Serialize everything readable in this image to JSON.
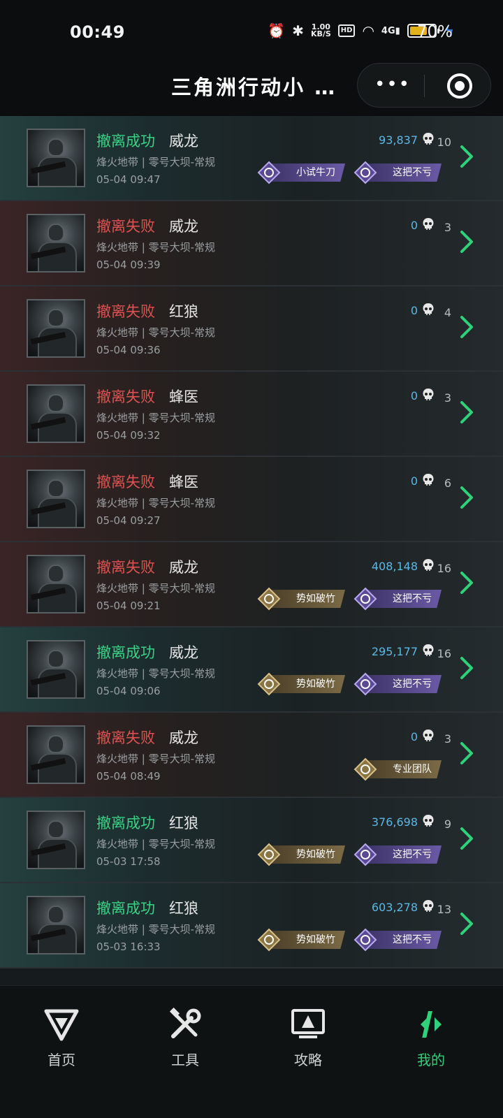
{
  "status_bar": {
    "time": "00:49",
    "speed_top": "1.00",
    "speed_bottom": "KB/S",
    "hd": "HD",
    "network": "4G",
    "battery_pct": "70%",
    "battery_level": 0.7
  },
  "header": {
    "title": "三角洲行动小 …"
  },
  "records": [
    {
      "result": "撤离成功",
      "result_type": "success",
      "operator": "威龙",
      "map": "烽火地带 | 零号大坝-常规",
      "time": "05-04 09:47",
      "value": "93,837",
      "kills": "10",
      "badges": [
        {
          "label": "小试牛刀",
          "color": "purple"
        },
        {
          "label": "这把不亏",
          "color": "purple"
        }
      ]
    },
    {
      "result": "撤离失败",
      "result_type": "fail",
      "operator": "威龙",
      "map": "烽火地带 | 零号大坝-常规",
      "time": "05-04 09:39",
      "value": "0",
      "kills": "3",
      "badges": []
    },
    {
      "result": "撤离失败",
      "result_type": "fail",
      "operator": "红狼",
      "map": "烽火地带 | 零号大坝-常规",
      "time": "05-04 09:36",
      "value": "0",
      "kills": "4",
      "badges": []
    },
    {
      "result": "撤离失败",
      "result_type": "fail",
      "operator": "蜂医",
      "map": "烽火地带 | 零号大坝-常规",
      "time": "05-04 09:32",
      "value": "0",
      "kills": "3",
      "badges": []
    },
    {
      "result": "撤离失败",
      "result_type": "fail",
      "operator": "蜂医",
      "map": "烽火地带 | 零号大坝-常规",
      "time": "05-04 09:27",
      "value": "0",
      "kills": "6",
      "badges": []
    },
    {
      "result": "撤离失败",
      "result_type": "fail",
      "operator": "威龙",
      "map": "烽火地带 | 零号大坝-常规",
      "time": "05-04 09:21",
      "value": "408,148",
      "kills": "16",
      "badges": [
        {
          "label": "势如破竹",
          "color": "gold"
        },
        {
          "label": "这把不亏",
          "color": "purple"
        }
      ]
    },
    {
      "result": "撤离成功",
      "result_type": "success",
      "operator": "威龙",
      "map": "烽火地带 | 零号大坝-常规",
      "time": "05-04 09:06",
      "value": "295,177",
      "kills": "16",
      "badges": [
        {
          "label": "势如破竹",
          "color": "gold"
        },
        {
          "label": "这把不亏",
          "color": "purple"
        }
      ]
    },
    {
      "result": "撤离失败",
      "result_type": "fail",
      "operator": "威龙",
      "map": "烽火地带 | 零号大坝-常规",
      "time": "05-04 08:49",
      "value": "0",
      "kills": "3",
      "badges": [
        {
          "label": "专业团队",
          "color": "gold"
        }
      ]
    },
    {
      "result": "撤离成功",
      "result_type": "success",
      "operator": "红狼",
      "map": "烽火地带 | 零号大坝-常规",
      "time": "05-03 17:58",
      "value": "376,698",
      "kills": "9",
      "badges": [
        {
          "label": "势如破竹",
          "color": "gold"
        },
        {
          "label": "这把不亏",
          "color": "purple"
        }
      ]
    },
    {
      "result": "撤离成功",
      "result_type": "success",
      "operator": "红狼",
      "map": "烽火地带 | 零号大坝-常规",
      "time": "05-03 16:33",
      "value": "603,278",
      "kills": "13",
      "badges": [
        {
          "label": "势如破竹",
          "color": "gold"
        },
        {
          "label": "这把不亏",
          "color": "purple"
        }
      ]
    }
  ],
  "nav": [
    {
      "label": "首页",
      "icon": "home-logo-icon",
      "active": false
    },
    {
      "label": "工具",
      "icon": "tools-icon",
      "active": false
    },
    {
      "label": "攻略",
      "icon": "guide-icon",
      "active": false
    },
    {
      "label": "我的",
      "icon": "profile-logo-icon",
      "active": true
    }
  ],
  "colors": {
    "success": "#38d385",
    "fail": "#e05151",
    "value": "#5bb8e6",
    "accent": "#2fd17a"
  }
}
